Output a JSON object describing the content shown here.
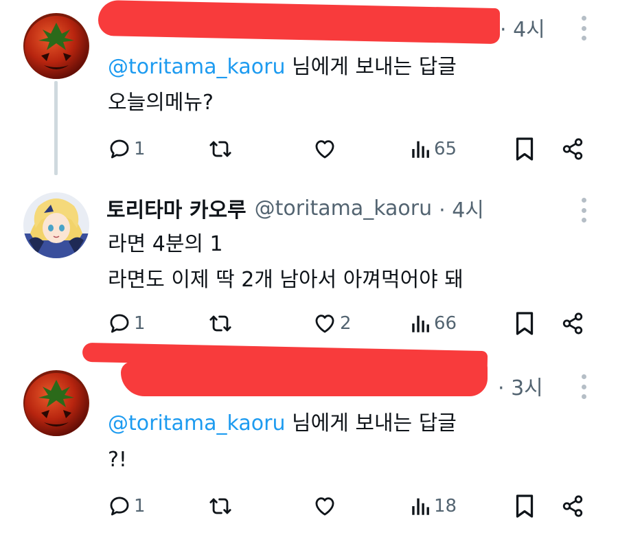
{
  "tweets": [
    {
      "author_redacted": true,
      "time": "· 4시",
      "reply_prefix": "@toritama_kaoru",
      "reply_suffix": " 님에게 보내는 답글",
      "text_lines": [
        "오늘의메뉴?"
      ],
      "replies": "1",
      "retweets": "",
      "likes": "",
      "views": "65"
    },
    {
      "author_redacted": false,
      "display_name": "토리타마 카오루",
      "handle": "@toritama_kaoru",
      "time": "· 4시",
      "text_lines": [
        "라면 4분의 1",
        "라면도 이제 딱 2개 남아서 아껴먹어야 돼"
      ],
      "replies": "1",
      "retweets": "",
      "likes": "2",
      "views": "66"
    },
    {
      "author_redacted": true,
      "time": "· 3시",
      "reply_prefix": "@toritama_kaoru",
      "reply_suffix": " 님에게 보내는 답글",
      "text_lines": [
        "?!"
      ],
      "replies": "1",
      "retweets": "",
      "likes": "",
      "views": "18"
    }
  ],
  "colors": {
    "mention": "#1d9bf0",
    "secondary_text": "#536471",
    "redaction": "#f83b3c",
    "thread_line": "#cfd9de"
  },
  "icons": [
    "reply-icon",
    "retweet-icon",
    "like-icon",
    "views-icon",
    "bookmark-icon",
    "share-icon",
    "more-icon"
  ]
}
